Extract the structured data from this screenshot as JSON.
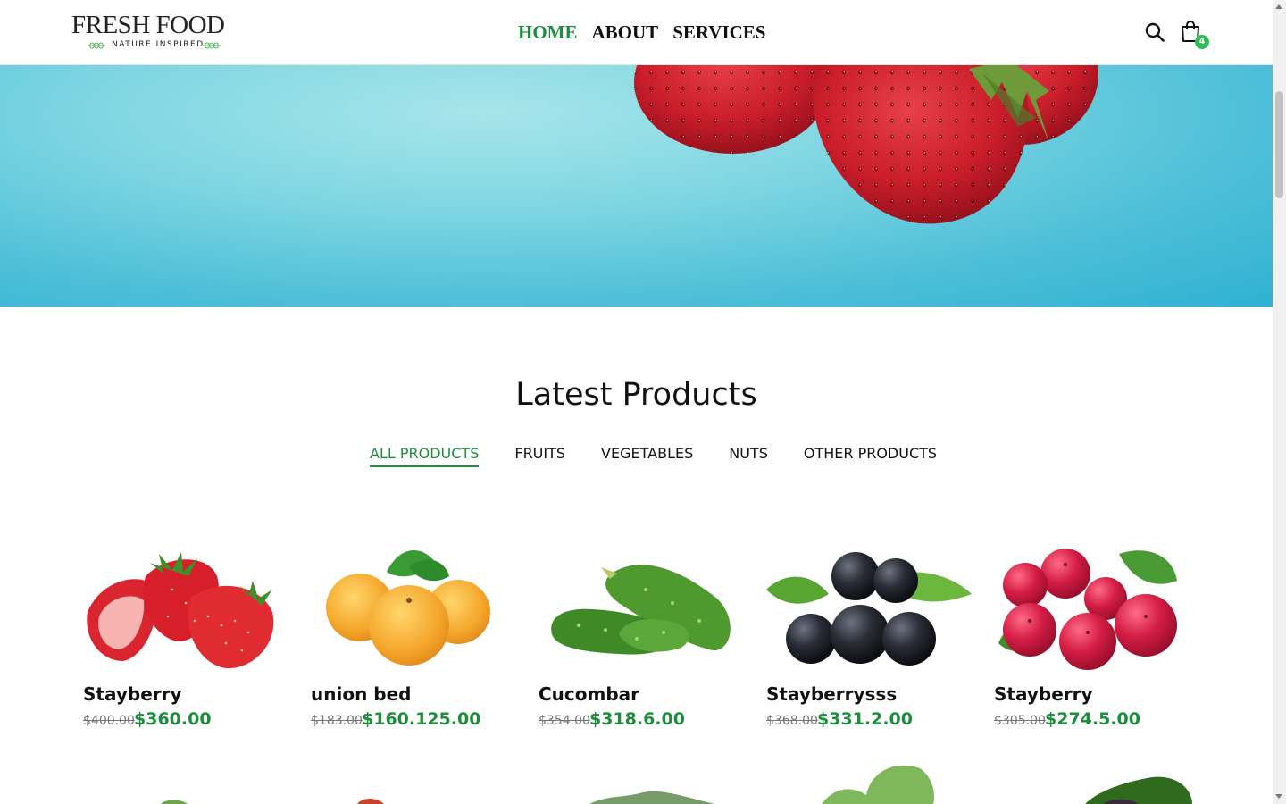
{
  "header": {
    "logo": {
      "main": "FRESH FOOD",
      "sub": "NATURE INSPIRED"
    },
    "nav": [
      {
        "label": "HOME",
        "active": true
      },
      {
        "label": "ABOUT",
        "active": false
      },
      {
        "label": "SERVICES",
        "active": false
      }
    ],
    "search_icon": "search-icon",
    "cart": {
      "icon": "shopping-bag-icon",
      "count": "4"
    }
  },
  "section": {
    "title": "Latest Products",
    "tabs": [
      {
        "label": "ALL PRODUCTS",
        "active": true
      },
      {
        "label": "FRUITS",
        "active": false
      },
      {
        "label": "VEGETABLES",
        "active": false
      },
      {
        "label": "NUTS",
        "active": false
      },
      {
        "label": "OTHER PRODUCTS",
        "active": false
      }
    ]
  },
  "products": [
    {
      "name": "Stayberry",
      "old_price": "$400.00",
      "price": "$360.00",
      "image": "strawberries"
    },
    {
      "name": "union bed",
      "old_price": "$183.00",
      "price": "$160.125.00",
      "image": "apricots"
    },
    {
      "name": "Cucombar",
      "old_price": "$354.00",
      "price": "$318.6.00",
      "image": "cucumbers"
    },
    {
      "name": "Stayberrysss",
      "old_price": "$368.00",
      "price": "$331.2.00",
      "image": "acai berries"
    },
    {
      "name": "Stayberry",
      "old_price": "$305.00",
      "price": "$274.5.00",
      "image": "cranberries"
    }
  ],
  "colors": {
    "accent": "#1e8e3e",
    "badge": "#2ebd59",
    "hero": "#4dbfd8"
  }
}
